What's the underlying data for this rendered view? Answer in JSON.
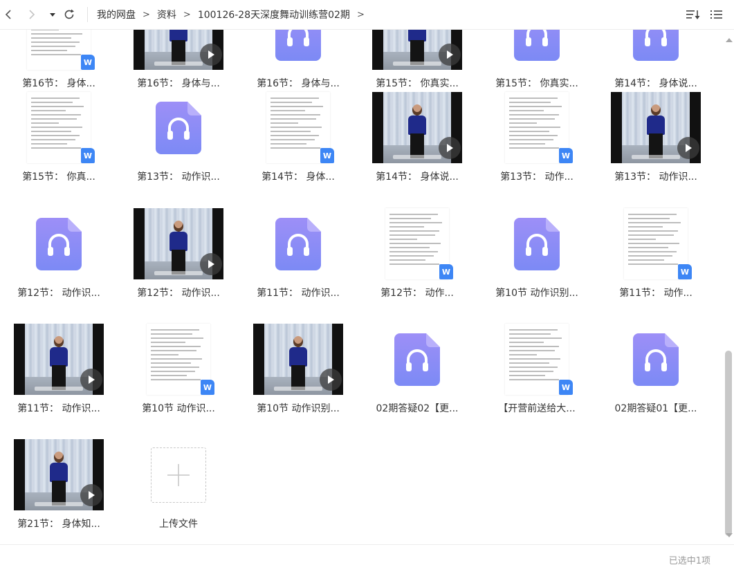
{
  "nav": {
    "back_icon": "chevron-left-icon",
    "forward_icon": "chevron-right-icon",
    "history_icon": "caret-down-icon",
    "refresh_icon": "refresh-icon",
    "breadcrumb": [
      "我的网盘",
      "资料",
      "100126-28天深度舞动训练营02期"
    ],
    "separator": ">",
    "sort_icon": "sort-icon",
    "list_view_icon": "list-view-icon"
  },
  "colors": {
    "audio_gradient_top": "#9d8ff7",
    "audio_gradient_bottom": "#7c8af5",
    "word_badge": "#3d86f5",
    "scroll_thumb": "#c8c8c8"
  },
  "files": [
    {
      "name": "第16节： 身体...",
      "type": "doc"
    },
    {
      "name": "第16节： 身体与...",
      "type": "video"
    },
    {
      "name": "第16节： 身体与...",
      "type": "audio"
    },
    {
      "name": "第15节： 你真实...",
      "type": "video"
    },
    {
      "name": "第15节： 你真实...",
      "type": "audio"
    },
    {
      "name": "第14节： 身体说...",
      "type": "audio"
    },
    {
      "name": "第15节：  你真...",
      "type": "doc"
    },
    {
      "name": "第13节： 动作识...",
      "type": "audio"
    },
    {
      "name": "第14节：  身体...",
      "type": "doc"
    },
    {
      "name": "第14节： 身体说...",
      "type": "video"
    },
    {
      "name": "第13节：  动作...",
      "type": "doc"
    },
    {
      "name": "第13节： 动作识...",
      "type": "video"
    },
    {
      "name": "第12节： 动作识...",
      "type": "audio"
    },
    {
      "name": "第12节： 动作识...",
      "type": "video"
    },
    {
      "name": "第11节： 动作识...",
      "type": "audio"
    },
    {
      "name": "第12节：  动作...",
      "type": "doc"
    },
    {
      "name": "第10节 动作识别...",
      "type": "audio"
    },
    {
      "name": "第11节：  动作...",
      "type": "doc"
    },
    {
      "name": "第11节： 动作识...",
      "type": "video"
    },
    {
      "name": "第10节   动作识...",
      "type": "doc"
    },
    {
      "name": "第10节 动作识别...",
      "type": "video"
    },
    {
      "name": "02期答疑02【更...",
      "type": "audio"
    },
    {
      "name": "【开营前送给大...",
      "type": "doc"
    },
    {
      "name": "02期答疑01【更...",
      "type": "audio"
    },
    {
      "name": "第21节： 身体知...",
      "type": "video"
    }
  ],
  "upload": {
    "label": "上传文件",
    "icon": "plus-icon"
  },
  "status": {
    "selected_text": "已选中1项"
  }
}
